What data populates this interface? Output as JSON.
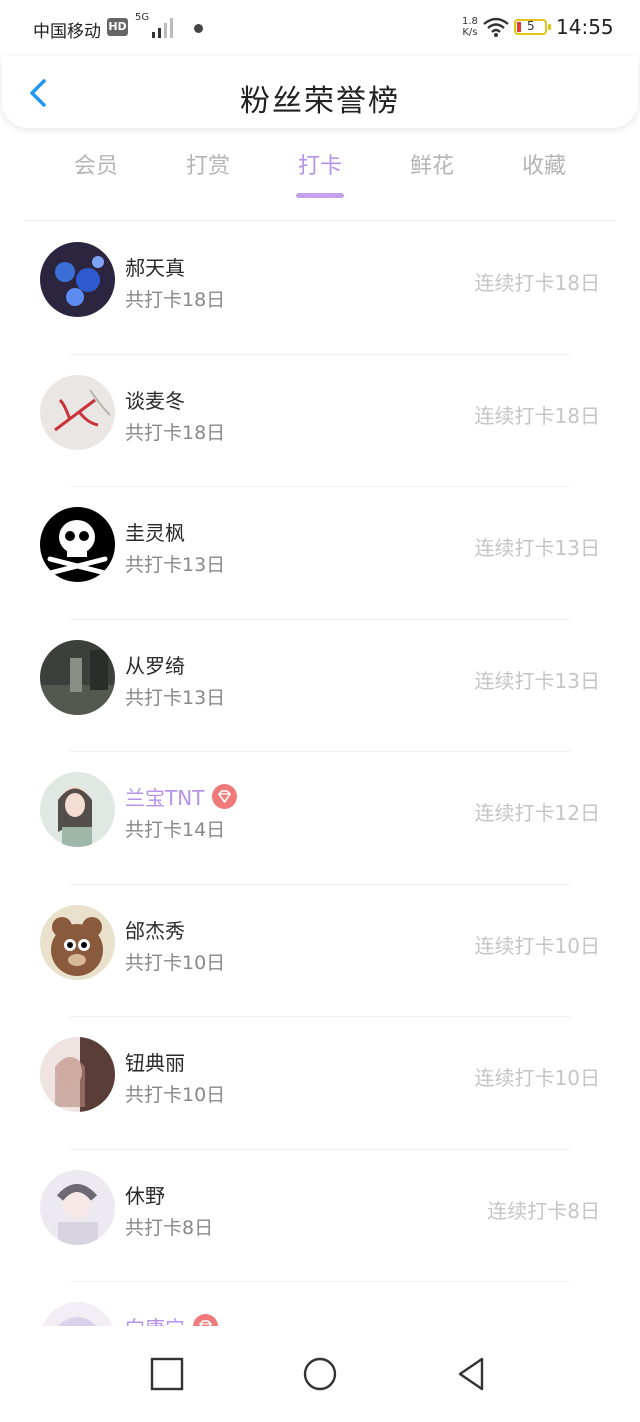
{
  "status_bar": {
    "carrier": "中国移动",
    "hd": "HD",
    "network": "5G",
    "speed_value": "1.8",
    "speed_unit": "K/s",
    "battery": "5",
    "time": "14:55"
  },
  "header": {
    "title": "粉丝荣誉榜",
    "back_icon": "chevron-left-icon"
  },
  "tabs": [
    {
      "label": "会员",
      "active": false
    },
    {
      "label": "打赏",
      "active": false
    },
    {
      "label": "打卡",
      "active": true
    },
    {
      "label": "鲜花",
      "active": false
    },
    {
      "label": "收藏",
      "active": false
    }
  ],
  "colors": {
    "accent": "#b692e8",
    "tab_underline": "#c6a1ee",
    "badge": "#f07a7a",
    "back_arrow": "#2196f3",
    "muted_text": "#c5c5c5"
  },
  "fans": [
    {
      "name": "郝天真",
      "total": "共打卡18日",
      "streak": "连续打卡18日",
      "vip": false,
      "avatar": "blue-figures"
    },
    {
      "name": "谈麦冬",
      "total": "共打卡18日",
      "streak": "连续打卡18日",
      "vip": false,
      "avatar": "red-branch"
    },
    {
      "name": "圭灵枫",
      "total": "共打卡13日",
      "streak": "连续打卡13日",
      "vip": false,
      "avatar": "skull"
    },
    {
      "name": "从罗绮",
      "total": "共打卡13日",
      "streak": "连续打卡13日",
      "vip": false,
      "avatar": "dark-street"
    },
    {
      "name": "兰宝TNT",
      "total": "共打卡14日",
      "streak": "连续打卡12日",
      "vip": true,
      "avatar": "girl-green"
    },
    {
      "name": "邰杰秀",
      "total": "共打卡10日",
      "streak": "连续打卡10日",
      "vip": false,
      "avatar": "bear"
    },
    {
      "name": "钮典丽",
      "total": "共打卡10日",
      "streak": "连续打卡10日",
      "vip": false,
      "avatar": "girl-pink"
    },
    {
      "name": "休野",
      "total": "共打卡8日",
      "streak": "连续打卡8日",
      "vip": false,
      "avatar": "pale-girl"
    },
    {
      "name": "向康宁",
      "total": "",
      "streak": "",
      "vip": true,
      "avatar": "anime-girl"
    }
  ],
  "nav": {
    "recent": "square-icon",
    "home": "circle-icon",
    "back": "triangle-back-icon"
  }
}
